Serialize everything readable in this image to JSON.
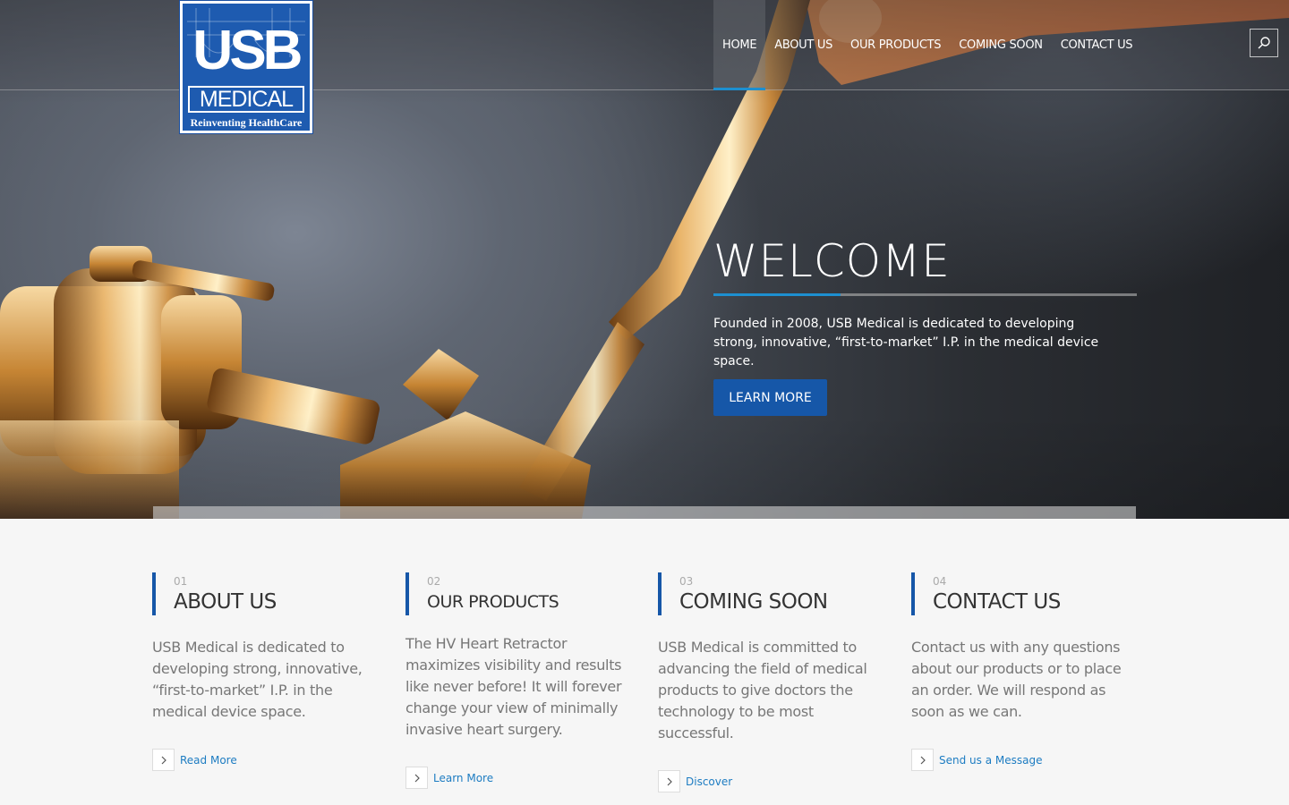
{
  "brand": {
    "logo_main": "USB",
    "logo_sub": "MEDICAL",
    "logo_tagline": "Reinventing HealthCare",
    "accent_color": "#1d8fd0",
    "button_color": "#1657a8"
  },
  "nav": {
    "items": [
      {
        "label": "HOME",
        "active": true
      },
      {
        "label": "ABOUT US"
      },
      {
        "label": "OUR PRODUCTS"
      },
      {
        "label": "COMING SOON"
      },
      {
        "label": "CONTACT US"
      }
    ],
    "search_icon": "search-icon"
  },
  "hero": {
    "title": "WELCOME",
    "text": "Founded in 2008, USB Medical is dedicated to developing strong, innovative, “first-to-market” I.P. in the medical device space.",
    "button": "LEARN MORE"
  },
  "features": [
    {
      "num": "01",
      "title": "ABOUT US",
      "text": "USB Medical is dedicated to developing strong, innovative, “first-to-market” I.P. in the medical device space.",
      "link": "Read More"
    },
    {
      "num": "02",
      "title": "OUR PRODUCTS",
      "text": "The HV Heart Retractor maximizes visibility and results like never before! It will forever change your view of minimally invasive heart surgery.",
      "link": "Learn More"
    },
    {
      "num": "03",
      "title": "COMING SOON",
      "text": "USB Medical is committed to advancing the field of medical products to give doctors the technology to be most successful.",
      "link": "Discover"
    },
    {
      "num": "04",
      "title": "CONTACT US",
      "text": "Contact us with any questions about our products or to place an order. We will respond as soon as we can.",
      "link": "Send us a Message"
    }
  ]
}
